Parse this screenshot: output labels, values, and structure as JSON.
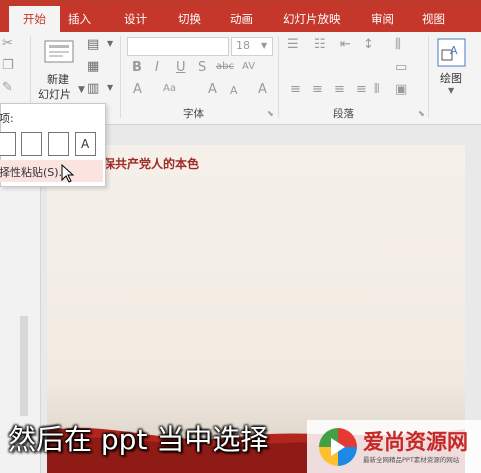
{
  "tabs": [
    "开始",
    "插入",
    "设计",
    "切换",
    "动画",
    "幻灯片放映",
    "审阅",
    "视图"
  ],
  "ribbon": {
    "new_slide_label_1": "新建",
    "new_slide_label_2": "幻灯片",
    "font_size_value": "18",
    "group_font": "字体",
    "group_paragraph": "段落",
    "drawing_label": "绘图",
    "bold": "B",
    "italic": "I",
    "underline": "U",
    "shadow": "S",
    "strike": "abc",
    "spacing": "AV",
    "aa": "Aa",
    "font_color": "A",
    "grow": "A",
    "shrink": "A",
    "clear_fmt": "A"
  },
  "dropdown": {
    "heading": "项:",
    "paste_special": "择性粘贴(S)..."
  },
  "slide": {
    "title": "保共产党人的本色"
  },
  "subtitle": "然后在 ppt 当中选择",
  "watermark": {
    "main": "爱尚资源网",
    "sub": "最新全网精品PPT素材资源的网站"
  },
  "icons": [
    "cut-icon",
    "copy-icon",
    "format-painter-icon",
    "layout-icon",
    "reset-icon",
    "section-icon",
    "bullets-icon",
    "numbering-icon",
    "line-spacing-icon",
    "text-direction-icon",
    "align-icon",
    "smartart-icon",
    "drawing-icon",
    "paste-icon",
    "mouse-cursor-icon"
  ],
  "colors": {
    "accent": "#c4372a",
    "title_red": "#a12a24"
  }
}
